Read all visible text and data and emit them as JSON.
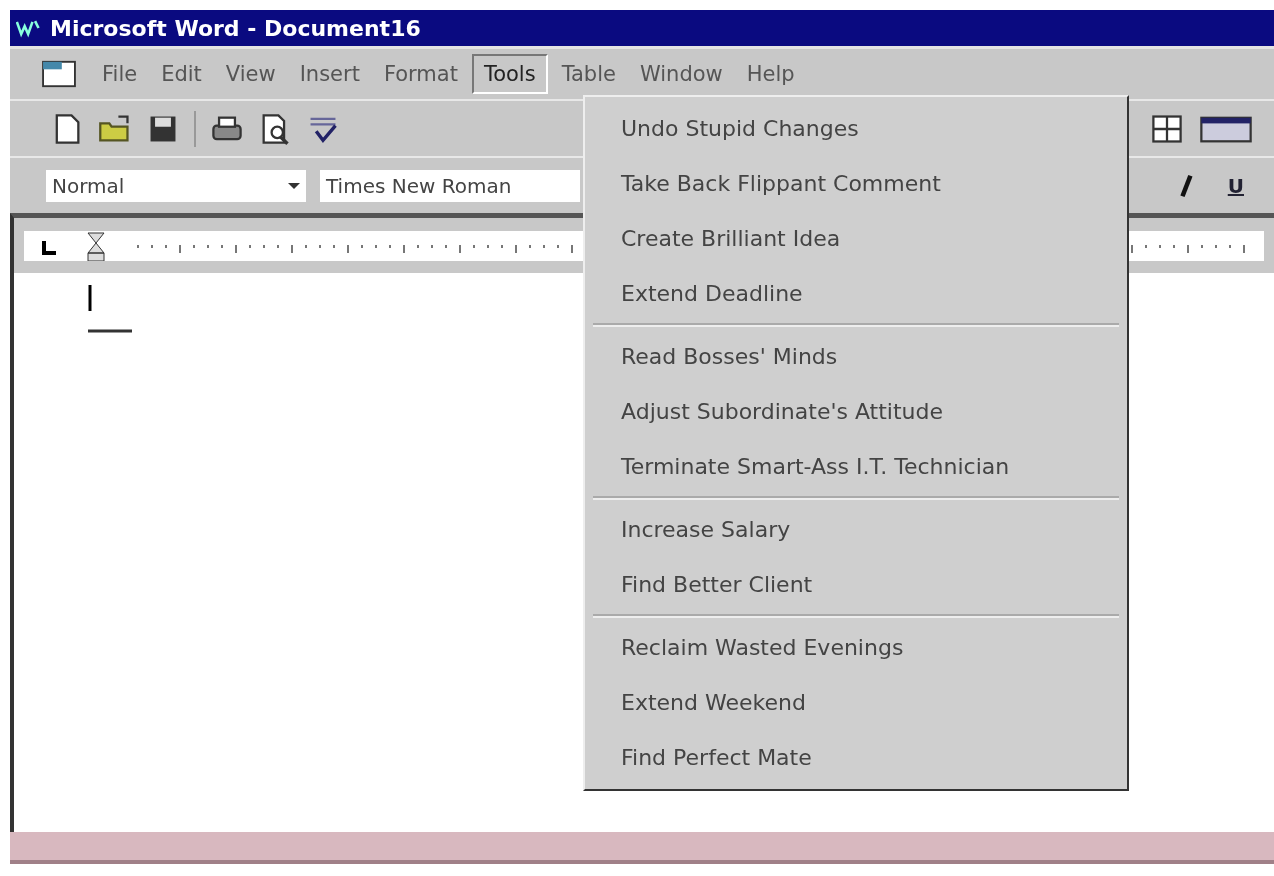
{
  "window": {
    "title": "Microsoft Word - Document16"
  },
  "menu_bar": [
    {
      "label": "File",
      "selected": false
    },
    {
      "label": "Edit",
      "selected": false
    },
    {
      "label": "View",
      "selected": false
    },
    {
      "label": "Insert",
      "selected": false
    },
    {
      "label": "Format",
      "selected": false
    },
    {
      "label": "Tools",
      "selected": true
    },
    {
      "label": "Table",
      "selected": false
    },
    {
      "label": "Window",
      "selected": false
    },
    {
      "label": "Help",
      "selected": false
    }
  ],
  "formatting_bar": {
    "style": "Normal",
    "font": "Times New Roman",
    "underline_button": "U"
  },
  "tools_menu": [
    [
      {
        "label": "Undo Stupid Changes"
      },
      {
        "label": "Take Back Flippant Comment"
      },
      {
        "label": "Create Brilliant Idea"
      },
      {
        "label": "Extend Deadline"
      }
    ],
    [
      {
        "label": "Read Bosses' Minds"
      },
      {
        "label": "Adjust Subordinate's Attitude"
      },
      {
        "label": "Terminate Smart-Ass I.T. Technician"
      }
    ],
    [
      {
        "label": "Increase Salary"
      },
      {
        "label": "Find Better Client"
      }
    ],
    [
      {
        "label": "Reclaim Wasted Evenings"
      },
      {
        "label": "Extend Weekend"
      },
      {
        "label": "Find Perfect Mate"
      }
    ]
  ]
}
